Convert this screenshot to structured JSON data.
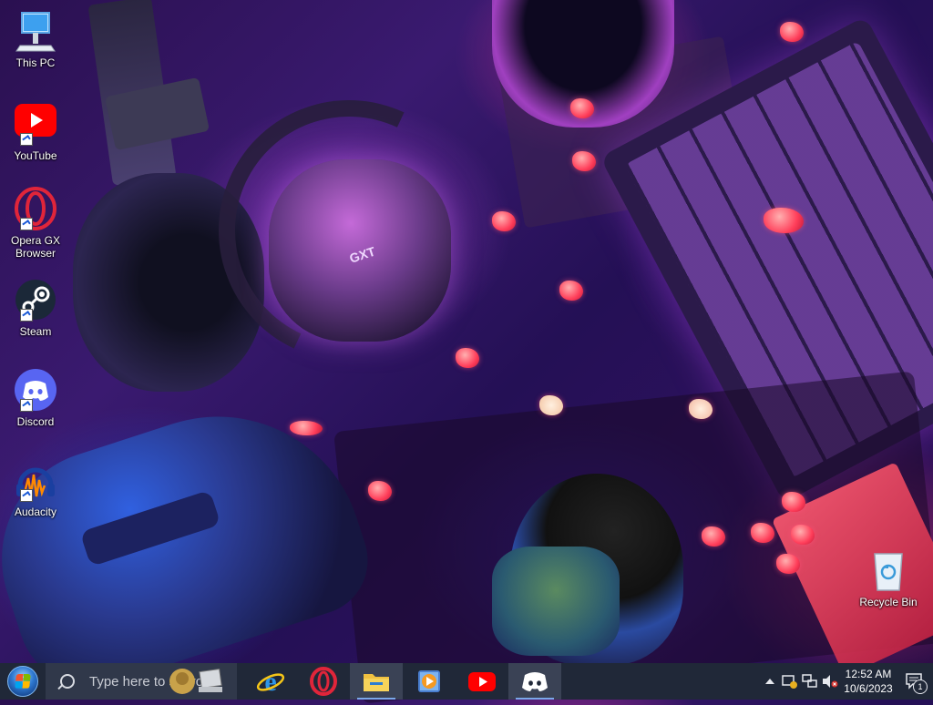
{
  "desktop": {
    "icons": [
      {
        "label": "This PC",
        "icon": "this-pc-icon"
      },
      {
        "label": "YouTube",
        "icon": "youtube-icon"
      },
      {
        "label": "Opera GX Browser",
        "icon": "opera-gx-icon"
      },
      {
        "label": "Steam",
        "icon": "steam-icon"
      },
      {
        "label": "Discord",
        "icon": "discord-icon"
      },
      {
        "label": "Audacity",
        "icon": "audacity-icon"
      }
    ],
    "recycle_bin": {
      "label": "Recycle Bin",
      "icon": "recycle-bin-icon"
    },
    "wallpaper": {
      "headset_logo": "GXT"
    }
  },
  "taskbar": {
    "search": {
      "placeholder": "Type here to search"
    },
    "apps": [
      {
        "name": "internet-explorer",
        "icon": "internet-explorer-icon"
      },
      {
        "name": "opera",
        "icon": "opera-icon"
      },
      {
        "name": "file-explorer",
        "icon": "file-explorer-icon"
      },
      {
        "name": "media-player",
        "icon": "media-player-icon"
      },
      {
        "name": "youtube",
        "icon": "youtube-icon"
      },
      {
        "name": "discord",
        "icon": "discord-icon"
      }
    ],
    "tray": {
      "time": "12:52 AM",
      "date": "10/6/2023",
      "notification_count": "1"
    }
  },
  "colors": {
    "taskbar_bg": "#202838",
    "youtube_red": "#ff0000",
    "discord_blurple": "#5865f2",
    "opera_red": "#e0253a",
    "steam_blue": "#1b2838"
  }
}
